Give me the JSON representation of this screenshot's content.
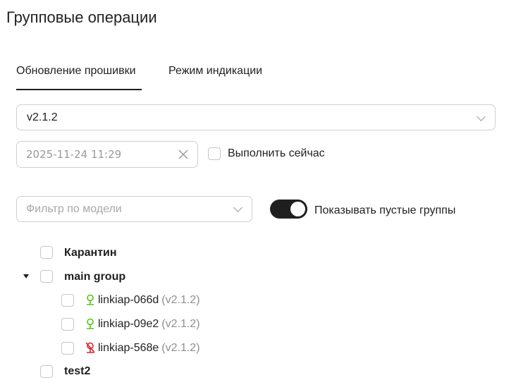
{
  "page": {
    "title": "Групповые операции"
  },
  "tabs": [
    {
      "label": "Обновление прошивки",
      "active": true
    },
    {
      "label": "Режим индикации",
      "active": false
    }
  ],
  "firmware": {
    "selected_version": "v2.1.2",
    "datetime_placeholder": "2025-11-24 11:29",
    "run_now_label": "Выполнить сейчас",
    "run_now_checked": false
  },
  "filter": {
    "model_placeholder": "Фильтр по модели",
    "show_empty_label": "Показывать пустые группы",
    "show_empty_on": true
  },
  "tree": {
    "groups": [
      {
        "name": "Карантин",
        "expanded": false,
        "checked": false
      },
      {
        "name": "main group",
        "expanded": true,
        "checked": false,
        "devices": [
          {
            "name": "linkiap-066d",
            "version": "(v2.1.2)",
            "status": "online",
            "status_color": "#52c41a"
          },
          {
            "name": "linkiap-09e2",
            "version": "(v2.1.2)",
            "status": "online",
            "status_color": "#52c41a"
          },
          {
            "name": "linkiap-568e",
            "version": "(v2.1.2)",
            "status": "offline",
            "status_color": "#d9252c"
          }
        ]
      },
      {
        "name": "test2",
        "expanded": false,
        "checked": false
      }
    ]
  },
  "icons": {
    "version_select": "chevron-down-icon",
    "datetime_clear": "close-icon",
    "model_filter": "chevron-down-icon",
    "group_expand": "caret-down-icon",
    "device_online": "network-online-icon",
    "device_offline": "network-offline-icon"
  }
}
